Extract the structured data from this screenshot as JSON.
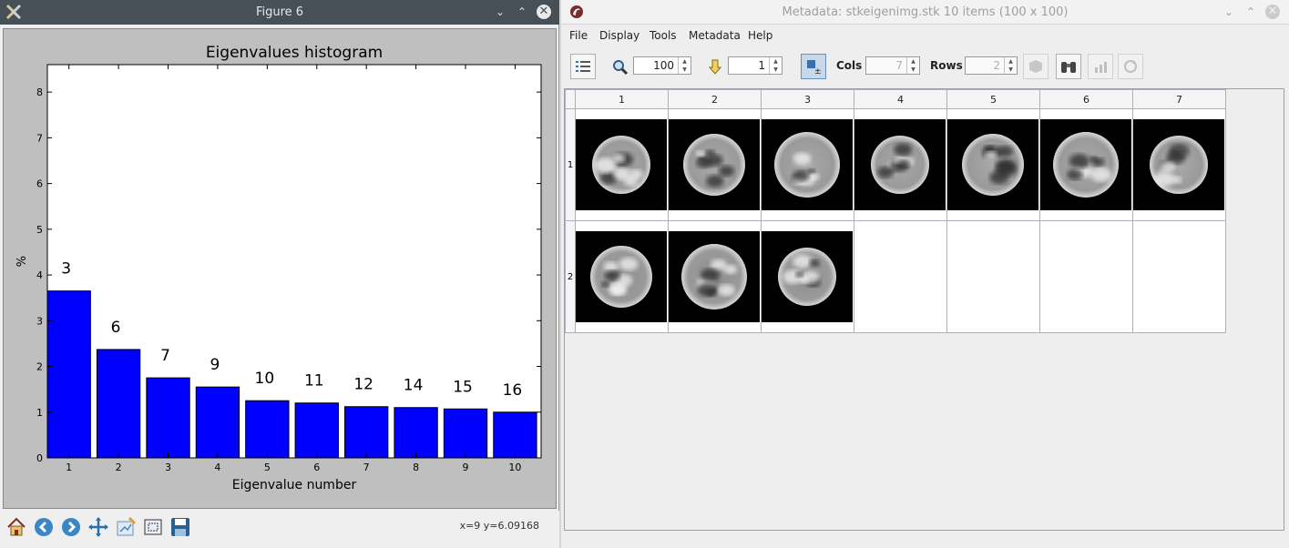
{
  "figure_window": {
    "title": "Figure 6",
    "coord_readout": "x=9 y=6.09168",
    "toolbar_icons": [
      "home-icon",
      "back-icon",
      "forward-icon",
      "pan-icon",
      "configure-subplots-icon",
      "zoom-rect-icon",
      "save-icon"
    ]
  },
  "chart_data": {
    "type": "bar",
    "title": "Eigenvalues histogram",
    "xlabel": "Eigenvalue number",
    "ylabel": "%",
    "categories": [
      "1",
      "2",
      "3",
      "4",
      "5",
      "6",
      "7",
      "8",
      "9",
      "10"
    ],
    "values": [
      3.65,
      2.37,
      1.75,
      1.55,
      1.25,
      1.2,
      1.12,
      1.1,
      1.07,
      1.0
    ],
    "bar_labels": [
      "3",
      "6",
      "7",
      "9",
      "10",
      "11",
      "12",
      "14",
      "15",
      "16"
    ],
    "ylim": [
      0,
      8.6
    ],
    "yticks": [
      "0",
      "1",
      "2",
      "3",
      "4",
      "5",
      "6",
      "7",
      "8"
    ],
    "bar_color": "#0000ff",
    "grid": false
  },
  "meta_window": {
    "title": "Metadata: stkeigenimg.stk 10 items (100 x 100)",
    "menu": [
      "File",
      "Display",
      "Tools",
      "Metadata",
      "Help"
    ],
    "toolbar": {
      "zoom_value": "100",
      "image_index_value": "1",
      "cols_label": "Cols",
      "cols_value": "7",
      "rows_label": "Rows",
      "rows_value": "2"
    },
    "grid": {
      "column_headers": [
        "1",
        "2",
        "3",
        "4",
        "5",
        "6",
        "7"
      ],
      "row_headers": [
        "1",
        "2"
      ],
      "item_count": 10
    }
  }
}
